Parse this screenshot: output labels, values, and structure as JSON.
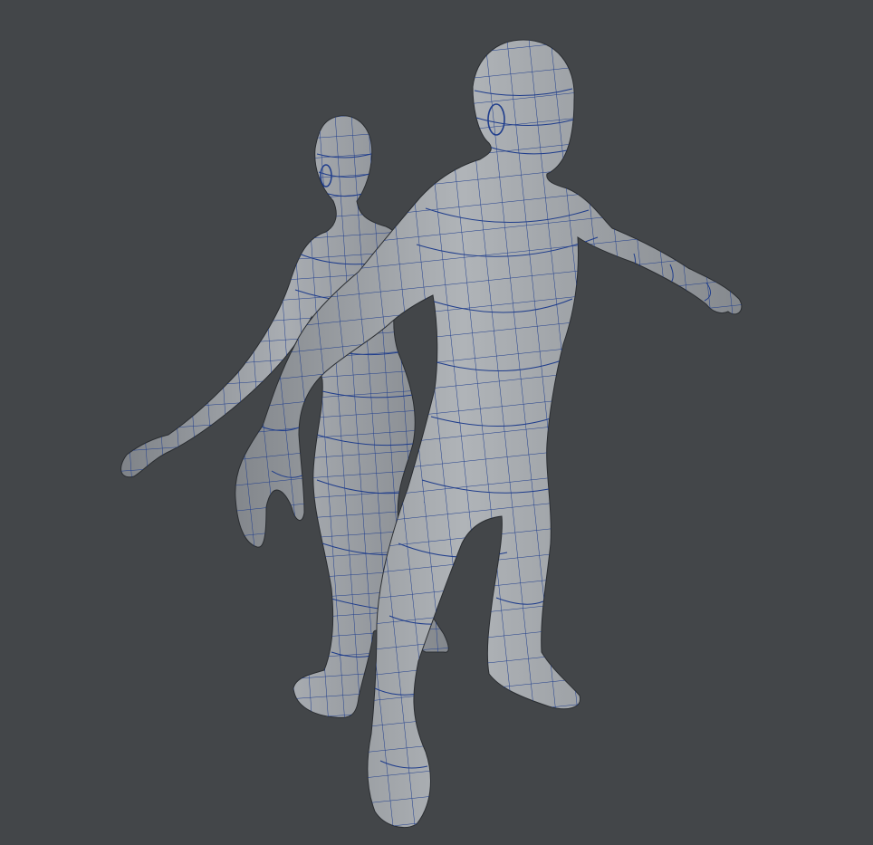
{
  "scene": {
    "type": "3d-viewport",
    "background_color": "#434649",
    "mesh_surface_color": "#9a9ea3",
    "wireframe_color": "#1e3a8a",
    "models": [
      {
        "id": "female-base-mesh",
        "shading": "smooth",
        "wireframe": true,
        "pose": "A-pose"
      },
      {
        "id": "male-base-mesh",
        "shading": "smooth",
        "wireframe": true,
        "pose": "A-pose"
      }
    ]
  }
}
